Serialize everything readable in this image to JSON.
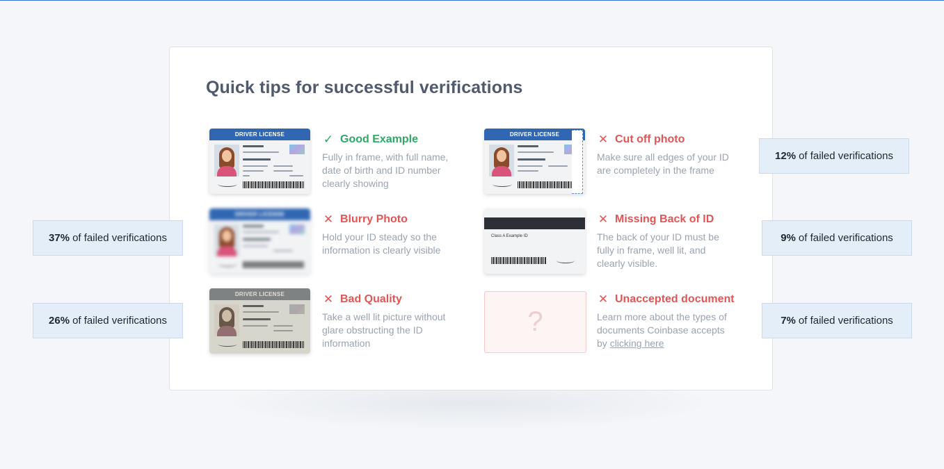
{
  "title": "Quick tips for successful verifications",
  "tips": {
    "good": {
      "mark": "✓",
      "heading": "Good Example",
      "description": "Fully in frame, with full name, date of birth and ID number clearly showing"
    },
    "blurry": {
      "mark": "✕",
      "heading": "Blurry Photo",
      "description": "Hold your ID steady so the information is clearly visible"
    },
    "quality": {
      "mark": "✕",
      "heading": "Bad Quality",
      "description": "Take a well lit picture without glare obstructing the ID information"
    },
    "cutoff": {
      "mark": "✕",
      "heading": "Cut off photo",
      "description": "Make sure all edges of your ID are completely in the frame"
    },
    "back": {
      "mark": "✕",
      "heading": "Missing Back of ID",
      "description": "The back of your ID must be fully in frame, well lit, and clearly visible."
    },
    "unaccepted": {
      "mark": "✕",
      "heading": "Unaccepted document",
      "description_prefix": "Learn more about the types of documents Coinbase accepts by ",
      "link_text": "clicking here",
      "placeholder_glyph": "?"
    }
  },
  "card_labels": {
    "front_title": "DRIVER LICENSE",
    "back_text": "Class A Example ID"
  },
  "stats": {
    "blurry": {
      "percent": "37%",
      "label": "of failed verifications"
    },
    "quality": {
      "percent": "26%",
      "label": "of failed verifications"
    },
    "cutoff": {
      "percent": "12%",
      "label": "of failed verifications"
    },
    "back": {
      "percent": "9%",
      "label": "of failed verifications"
    },
    "unaccepted": {
      "percent": "7%",
      "label": "of failed verifications"
    }
  },
  "colors": {
    "good": "#2fa866",
    "bad": "#e25555",
    "stat_bg": "#e4eef8",
    "id_band": "#3167b2"
  }
}
